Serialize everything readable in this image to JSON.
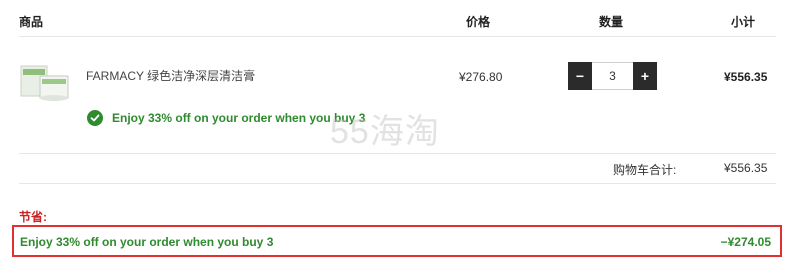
{
  "table": {
    "headers": {
      "product": "商品",
      "price": "价格",
      "quantity": "数量",
      "subtotal": "小计"
    }
  },
  "item": {
    "name": "FARMACY 绿色洁净深层清洁膏",
    "price": "¥276.80",
    "quantity": "3",
    "decrement_label": "−",
    "increment_label": "+",
    "subtotal": "¥556.35",
    "promo_text": "Enjoy 33% off on your order when you buy 3",
    "promo_icon": "check-circle-icon"
  },
  "watermark": "55海淘",
  "cart_total": {
    "label": "购物车合计:",
    "value": "¥556.35"
  },
  "savings": {
    "label": "节省:",
    "description": "Enjoy 33% off on your order when you buy 3",
    "amount": "−¥274.05"
  },
  "colors": {
    "promo_green": "#2e8b2e",
    "highlight_red": "#e03030",
    "stepper_dark": "#2b2b2b"
  }
}
